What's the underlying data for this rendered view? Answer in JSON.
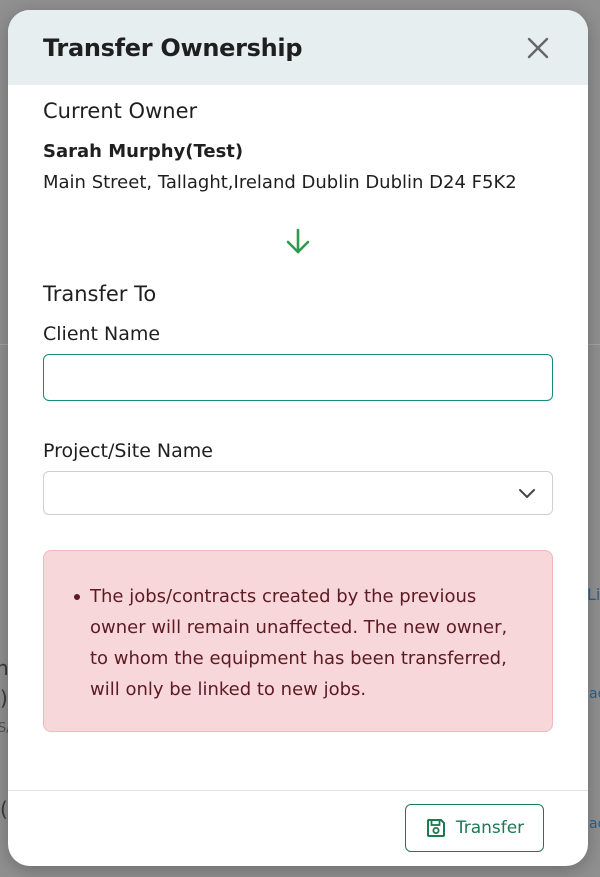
{
  "background": {
    "fragments": [
      "ne",
      ")",
      "S/",
      "(",
      "Li",
      "ad",
      "ad",
      "ad"
    ]
  },
  "modal": {
    "title": "Transfer Ownership",
    "close_icon": "close-icon",
    "current_owner": {
      "heading": "Current Owner",
      "name": "Sarah Murphy(Test)",
      "address": "Main Street, Tallaght,Ireland Dublin Dublin D24 F5K2"
    },
    "arrow_icon": "arrow-down-icon",
    "transfer_to": {
      "heading": "Transfer To",
      "client_name_label": "Client Name",
      "client_name_value": "",
      "project_site_label": "Project/Site Name",
      "project_site_value": ""
    },
    "alert": {
      "items": [
        "The jobs/contracts created by the previous owner will remain unaffected. The new owner, to whom the equipment has been transferred, will only be linked to new jobs."
      ]
    },
    "footer": {
      "transfer_label": "Transfer",
      "transfer_icon": "save-icon"
    }
  },
  "colors": {
    "accent": "#1a7a52",
    "input_focus": "#1a8a7a",
    "alert_bg": "#f8d7da",
    "alert_text": "#5c1a22",
    "header_bg": "#e6eef0",
    "arrow": "#2e9a4e"
  }
}
